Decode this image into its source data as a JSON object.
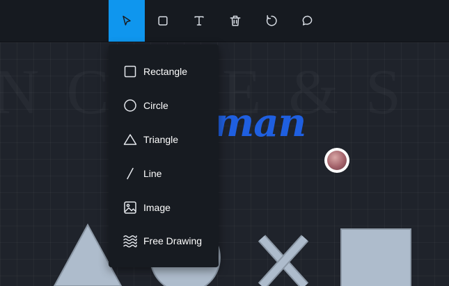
{
  "toolbar": {
    "tools": [
      {
        "name": "select",
        "icon": "cursor-arrow-icon",
        "active": true
      },
      {
        "name": "rectangle",
        "icon": "square-icon",
        "active": false
      },
      {
        "name": "text",
        "icon": "text-t-icon",
        "active": false
      },
      {
        "name": "delete",
        "icon": "trash-icon",
        "active": false
      },
      {
        "name": "reset",
        "icon": "refresh-icon",
        "active": false
      },
      {
        "name": "comment",
        "icon": "chat-bubble-icon",
        "active": false
      }
    ],
    "accent": "#0f96ee"
  },
  "shape_menu": {
    "items": [
      {
        "label": "Rectangle",
        "icon": "square-icon"
      },
      {
        "label": "Circle",
        "icon": "circle-icon"
      },
      {
        "label": "Triangle",
        "icon": "triangle-icon"
      },
      {
        "label": "Line",
        "icon": "line-icon"
      },
      {
        "label": "Image",
        "icon": "image-icon"
      },
      {
        "label": "Free Drawing",
        "icon": "waves-icon"
      }
    ]
  },
  "canvas": {
    "watermark_text": "N C     ATE & S",
    "script_text": "man",
    "script_color": "#1f5fe0",
    "shape_fill": "#aebccc"
  }
}
